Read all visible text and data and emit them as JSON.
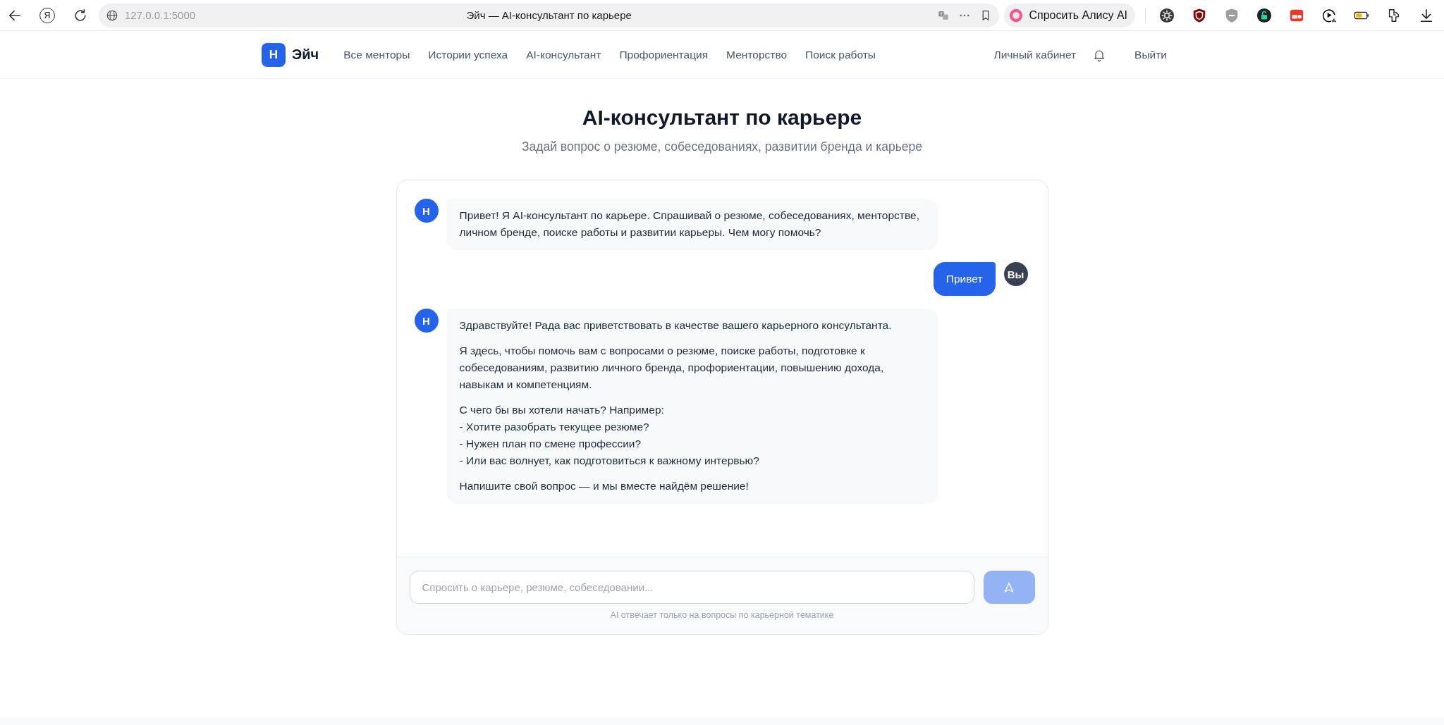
{
  "browser": {
    "home_glyph": "Я",
    "url": "127.0.0.1:5000",
    "page_title": "Эйч — AI-консультант по карьере",
    "assistant_button": "Спросить Алису AI"
  },
  "navbar": {
    "logo_letter": "H",
    "brand": "Эйч",
    "links": [
      "Все менторы",
      "Истории успеха",
      "AI-консультант",
      "Профориентация",
      "Менторство",
      "Поиск работы"
    ],
    "account_link": "Личный кабинет",
    "logout_button": "Выйти"
  },
  "header": {
    "title": "AI-консультант по карьере",
    "subtitle": "Задай вопрос о резюме, собеседованиях, развитии бренда и карьере"
  },
  "chat": {
    "messages": [
      {
        "kind": "assistant",
        "avatar": "H",
        "paragraphs": [
          "Привет! Я AI-консультант по карьере. Спрашивай о резюме, собеседованиях, менторстве, личном бренде, поиске работы и развитии карьеры. Чем могу помочь?"
        ]
      },
      {
        "kind": "user",
        "avatar": "Вы",
        "paragraphs": [
          "Привет"
        ]
      },
      {
        "kind": "assistant",
        "avatar": "H",
        "paragraphs": [
          "Здравствуйте! Рада вас приветствовать в качестве вашего карьерного консультанта.",
          "Я здесь, чтобы помочь вам с вопросами о резюме, поиске работы, подготовке к собеседованиям, развитию личного бренда, профориентации, повышению дохода, навыкам и компетенциям.",
          "С чего бы вы хотели начать? Например:\n- Хотите разобрать текущее резюме?\n- Нужен план по смене профессии?\n- Или вас волнует, как подготовиться к важному интервью?",
          "Напишите свой вопрос — и мы вместе найдём решение!"
        ]
      }
    ],
    "input": {
      "placeholder": "Спросить о карьере, резюме, собеседовании..."
    },
    "send_button": {
      "disabled": true
    },
    "disclaimer": "AI отвечает только на вопросы по карьерной тематике"
  }
}
